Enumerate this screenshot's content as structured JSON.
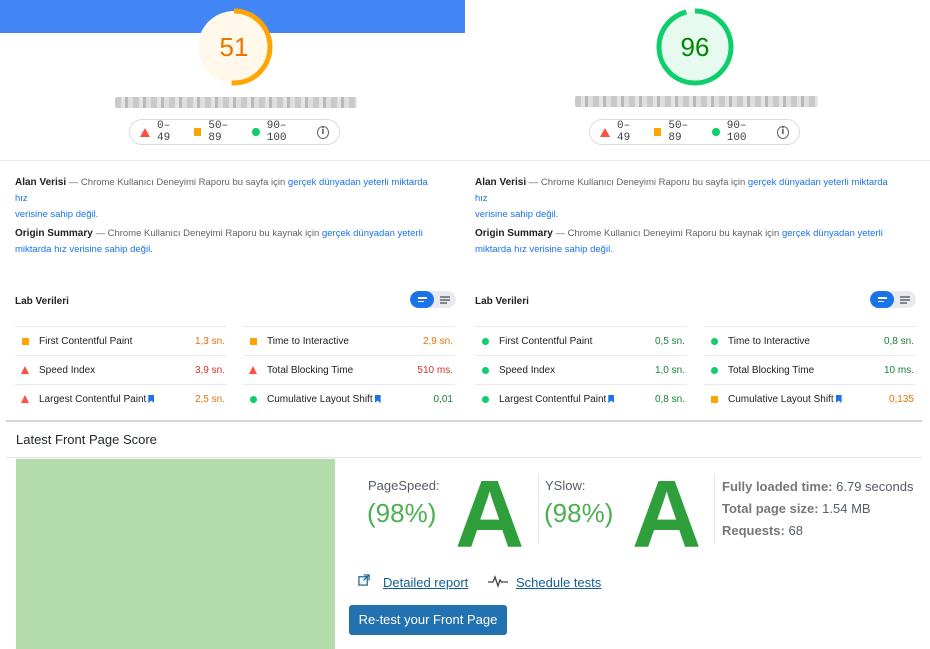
{
  "left": {
    "score": "51",
    "legend": {
      "red": "0–49",
      "orange": "50–89",
      "green": "90–100"
    },
    "field_data": {
      "title": "Alan Verisi",
      "text": " — Chrome Kullanıcı Deneyimi Raporu bu sayfa için ",
      "link1": "gerçek dünyadan yeterli miktarda hız",
      "link2": "verisine sahip değil."
    },
    "origin_summary": {
      "title": "Origin Summary",
      "text": " — Chrome Kullanıcı Deneyimi Raporu bu kaynak için ",
      "link1": "gerçek dünyadan yeterli",
      "link2": "miktarda hız verisine sahip değil."
    },
    "lab_title": "Lab Verileri",
    "metrics": [
      {
        "label": "First Contentful Paint",
        "value": "1,3 sn."
      },
      {
        "label": "Time to Interactive",
        "value": "2,9 sn."
      },
      {
        "label": "Speed Index",
        "value": "3,9 sn."
      },
      {
        "label": "Total Blocking Time",
        "value": "510 ms."
      },
      {
        "label": "Largest Contentful Paint",
        "value": "2,5 sn."
      },
      {
        "label": "Cumulative Layout Shift",
        "value": "0,01"
      }
    ]
  },
  "right": {
    "score": "96",
    "legend": {
      "red": "0–49",
      "orange": "50–89",
      "green": "90–100"
    },
    "field_data": {
      "title": "Alan Verisi",
      "text": " — Chrome Kullanıcı Deneyimi Raporu bu sayfa için ",
      "link1": "gerçek dünyadan yeterli miktarda hız",
      "link2": "verisine sahip değil."
    },
    "origin_summary": {
      "title": "Origin Summary",
      "text": " — Chrome Kullanıcı Deneyimi Raporu bu kaynak için ",
      "link1": "gerçek dünyadan yeterli",
      "link2": "miktarda hız verisine sahip değil."
    },
    "lab_title": "Lab Verileri",
    "metrics": [
      {
        "label": "First Contentful Paint",
        "value": "0,5 sn."
      },
      {
        "label": "Time to Interactive",
        "value": "0,8 sn."
      },
      {
        "label": "Speed Index",
        "value": "1,0 sn."
      },
      {
        "label": "Total Blocking Time",
        "value": "10 ms."
      },
      {
        "label": "Largest Contentful Paint",
        "value": "0,8 sn."
      },
      {
        "label": "Cumulative Layout Shift",
        "value": "0,135"
      }
    ]
  },
  "gtmetrix": {
    "title": "Latest Front Page Score",
    "pagespeed_label": "PageSpeed:",
    "pagespeed_pct": "(98%)",
    "pagespeed_grade": "A",
    "yslow_label": "YSlow:",
    "yslow_pct": "(98%)",
    "yslow_grade": "A",
    "fully_loaded_label": "Fully loaded time:",
    "fully_loaded_value": " 6.79 seconds",
    "page_size_label": "Total page size:",
    "page_size_value": " 1.54 MB",
    "requests_label": "Requests:",
    "requests_value": " 68",
    "detailed_report": "Detailed report",
    "schedule_tests": "Schedule tests",
    "retest_button": "Re-test your Front Page"
  },
  "colors": {
    "red": "#ff4e42",
    "orange": "#ffa400",
    "green": "#0cce6b",
    "link_blue": "#1a73e8",
    "wp_button": "#2271b1",
    "thumbnail": "#b3dbac"
  }
}
